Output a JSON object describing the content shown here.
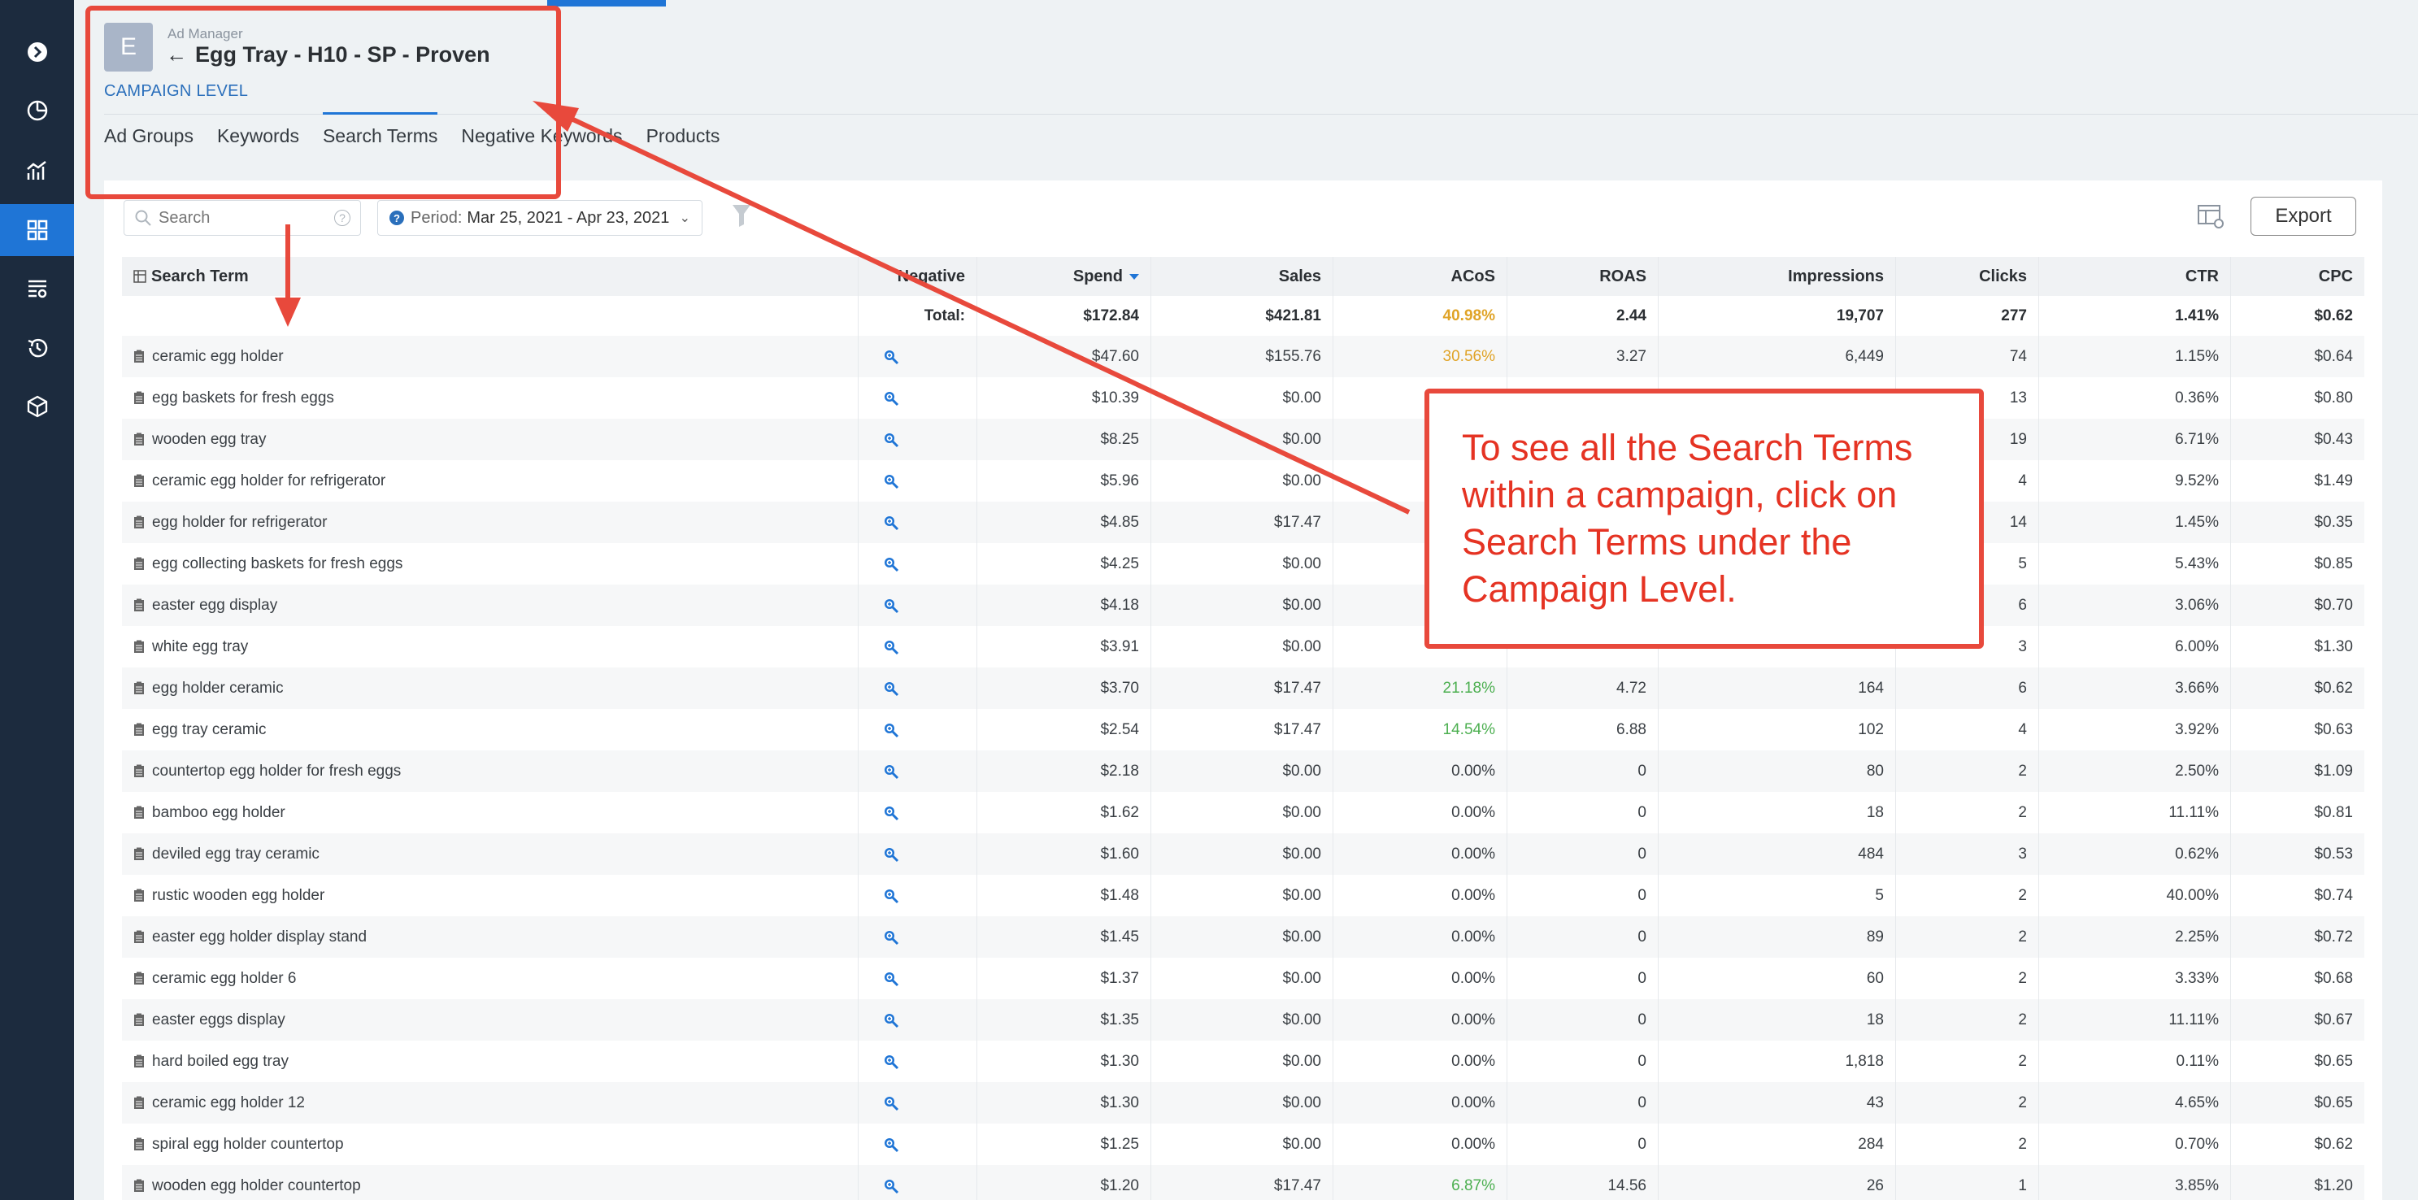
{
  "sidebar": {
    "items": [
      {
        "icon": "arrow-circle-right-icon"
      },
      {
        "icon": "clock-pie-icon"
      },
      {
        "icon": "analytics-icon"
      },
      {
        "icon": "grid-icon",
        "active": true
      },
      {
        "icon": "list-settings-icon"
      },
      {
        "icon": "history-icon"
      },
      {
        "icon": "box-icon"
      }
    ]
  },
  "header": {
    "avatar_letter": "E",
    "breadcrumb": "Ad Manager",
    "back_arrow": "←",
    "title": "Egg Tray - H10 - SP - Proven",
    "level": "CAMPAIGN LEVEL"
  },
  "tabs": [
    {
      "label": "Ad Groups"
    },
    {
      "label": "Keywords"
    },
    {
      "label": "Search Terms",
      "active": true
    },
    {
      "label": "Negative Keywords"
    },
    {
      "label": "Products"
    }
  ],
  "toolbar": {
    "search_placeholder": "Search",
    "help_glyph": "?",
    "period_label": "Period:",
    "period_value": "Mar 25, 2021 - Apr 23, 2021",
    "export_label": "Export"
  },
  "table": {
    "headers": {
      "term": "Search Term",
      "negative": "Negative",
      "spend": "Spend",
      "sales": "Sales",
      "acos": "ACoS",
      "roas": "ROAS",
      "impressions": "Impressions",
      "clicks": "Clicks",
      "ctr": "CTR",
      "cpc": "CPC"
    },
    "total": {
      "label": "Total:",
      "spend": "$172.84",
      "sales": "$421.81",
      "acos": "40.98%",
      "roas": "2.44",
      "impressions": "19,707",
      "clicks": "277",
      "ctr": "1.41%",
      "cpc": "$0.62"
    },
    "rows": [
      {
        "term": "ceramic egg holder",
        "spend": "$47.60",
        "sales": "$155.76",
        "acos": "30.56%",
        "acos_color": "#e0a326",
        "roas": "3.27",
        "impressions": "6,449",
        "clicks": "74",
        "ctr": "1.15%",
        "cpc": "$0.64"
      },
      {
        "term": "egg baskets for fresh eggs",
        "spend": "$10.39",
        "sales": "$0.00",
        "acos": "",
        "roas": "",
        "impressions": "",
        "clicks": "13",
        "ctr": "0.36%",
        "cpc": "$0.80"
      },
      {
        "term": "wooden egg tray",
        "spend": "$8.25",
        "sales": "$0.00",
        "acos": "",
        "roas": "",
        "impressions": "",
        "clicks": "19",
        "ctr": "6.71%",
        "cpc": "$0.43"
      },
      {
        "term": "ceramic egg holder for refrigerator",
        "spend": "$5.96",
        "sales": "$0.00",
        "acos": "",
        "roas": "",
        "impressions": "",
        "clicks": "4",
        "ctr": "9.52%",
        "cpc": "$1.49"
      },
      {
        "term": "egg holder for refrigerator",
        "spend": "$4.85",
        "sales": "$17.47",
        "acos": "",
        "roas": "",
        "impressions": "",
        "clicks": "14",
        "ctr": "1.45%",
        "cpc": "$0.35"
      },
      {
        "term": "egg collecting baskets for fresh eggs",
        "spend": "$4.25",
        "sales": "$0.00",
        "acos": "",
        "roas": "",
        "impressions": "",
        "clicks": "5",
        "ctr": "5.43%",
        "cpc": "$0.85"
      },
      {
        "term": "easter egg display",
        "spend": "$4.18",
        "sales": "$0.00",
        "acos": "",
        "roas": "",
        "impressions": "",
        "clicks": "6",
        "ctr": "3.06%",
        "cpc": "$0.70"
      },
      {
        "term": "white egg tray",
        "spend": "$3.91",
        "sales": "$0.00",
        "acos": "",
        "roas": "",
        "impressions": "",
        "clicks": "3",
        "ctr": "6.00%",
        "cpc": "$1.30"
      },
      {
        "term": "egg holder ceramic",
        "spend": "$3.70",
        "sales": "$17.47",
        "acos": "21.18%",
        "acos_color": "#4caf50",
        "roas": "4.72",
        "impressions": "164",
        "clicks": "6",
        "ctr": "3.66%",
        "cpc": "$0.62"
      },
      {
        "term": "egg tray ceramic",
        "spend": "$2.54",
        "sales": "$17.47",
        "acos": "14.54%",
        "acos_color": "#4caf50",
        "roas": "6.88",
        "impressions": "102",
        "clicks": "4",
        "ctr": "3.92%",
        "cpc": "$0.63"
      },
      {
        "term": "countertop egg holder for fresh eggs",
        "spend": "$2.18",
        "sales": "$0.00",
        "acos": "0.00%",
        "roas": "0",
        "impressions": "80",
        "clicks": "2",
        "ctr": "2.50%",
        "cpc": "$1.09"
      },
      {
        "term": "bamboo egg holder",
        "spend": "$1.62",
        "sales": "$0.00",
        "acos": "0.00%",
        "roas": "0",
        "impressions": "18",
        "clicks": "2",
        "ctr": "11.11%",
        "cpc": "$0.81"
      },
      {
        "term": "deviled egg tray ceramic",
        "spend": "$1.60",
        "sales": "$0.00",
        "acos": "0.00%",
        "roas": "0",
        "impressions": "484",
        "clicks": "3",
        "ctr": "0.62%",
        "cpc": "$0.53"
      },
      {
        "term": "rustic wooden egg holder",
        "spend": "$1.48",
        "sales": "$0.00",
        "acos": "0.00%",
        "roas": "0",
        "impressions": "5",
        "clicks": "2",
        "ctr": "40.00%",
        "cpc": "$0.74"
      },
      {
        "term": "easter egg holder display stand",
        "spend": "$1.45",
        "sales": "$0.00",
        "acos": "0.00%",
        "roas": "0",
        "impressions": "89",
        "clicks": "2",
        "ctr": "2.25%",
        "cpc": "$0.72"
      },
      {
        "term": "ceramic egg holder 6",
        "spend": "$1.37",
        "sales": "$0.00",
        "acos": "0.00%",
        "roas": "0",
        "impressions": "60",
        "clicks": "2",
        "ctr": "3.33%",
        "cpc": "$0.68"
      },
      {
        "term": "easter eggs display",
        "spend": "$1.35",
        "sales": "$0.00",
        "acos": "0.00%",
        "roas": "0",
        "impressions": "18",
        "clicks": "2",
        "ctr": "11.11%",
        "cpc": "$0.67"
      },
      {
        "term": "hard boiled egg tray",
        "spend": "$1.30",
        "sales": "$0.00",
        "acos": "0.00%",
        "roas": "0",
        "impressions": "1,818",
        "clicks": "2",
        "ctr": "0.11%",
        "cpc": "$0.65"
      },
      {
        "term": "ceramic egg holder 12",
        "spend": "$1.30",
        "sales": "$0.00",
        "acos": "0.00%",
        "roas": "0",
        "impressions": "43",
        "clicks": "2",
        "ctr": "4.65%",
        "cpc": "$0.65"
      },
      {
        "term": "spiral egg holder countertop",
        "spend": "$1.25",
        "sales": "$0.00",
        "acos": "0.00%",
        "roas": "0",
        "impressions": "284",
        "clicks": "2",
        "ctr": "0.70%",
        "cpc": "$0.62"
      },
      {
        "term": "wooden egg holder countertop",
        "spend": "$1.20",
        "sales": "$17.47",
        "acos": "6.87%",
        "acos_color": "#4caf50",
        "roas": "14.56",
        "impressions": "26",
        "clicks": "1",
        "ctr": "3.85%",
        "cpc": "$1.20"
      }
    ]
  },
  "annotation": {
    "text": "To see all the Search Terms within a campaign, click on Search Terms under the Campaign Level.",
    "color": "#e8493c"
  },
  "colors": {
    "sidebar_bg": "#1c2b3e",
    "accent": "#1f75d6",
    "acos_orange": "#e0a326",
    "acos_green": "#4caf50"
  }
}
